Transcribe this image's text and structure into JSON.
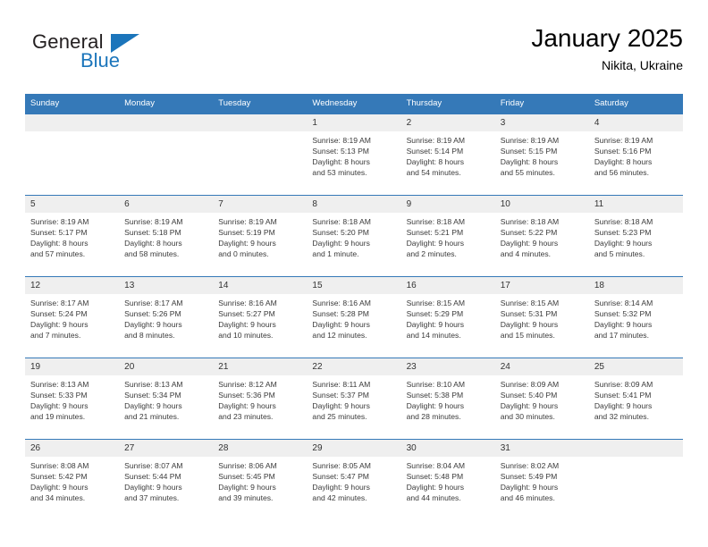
{
  "brand": {
    "name_top": "General",
    "name_bottom": "Blue",
    "triangle_color": "#1b75bb",
    "top_color": "#231f20",
    "bottom_color": "#1b75bb"
  },
  "header": {
    "title": "January 2025",
    "location": "Nikita, Ukraine"
  },
  "theme": {
    "header_bg": "#3579b8",
    "header_text": "#ffffff",
    "daynum_bg": "#efefef",
    "row_border": "#3579b8"
  },
  "weekdays": [
    "Sunday",
    "Monday",
    "Tuesday",
    "Wednesday",
    "Thursday",
    "Friday",
    "Saturday"
  ],
  "weeks": [
    [
      {
        "day": "",
        "details": ""
      },
      {
        "day": "",
        "details": ""
      },
      {
        "day": "",
        "details": ""
      },
      {
        "day": "1",
        "details": "Sunrise: 8:19 AM\nSunset: 5:13 PM\nDaylight: 8 hours\nand 53 minutes."
      },
      {
        "day": "2",
        "details": "Sunrise: 8:19 AM\nSunset: 5:14 PM\nDaylight: 8 hours\nand 54 minutes."
      },
      {
        "day": "3",
        "details": "Sunrise: 8:19 AM\nSunset: 5:15 PM\nDaylight: 8 hours\nand 55 minutes."
      },
      {
        "day": "4",
        "details": "Sunrise: 8:19 AM\nSunset: 5:16 PM\nDaylight: 8 hours\nand 56 minutes."
      }
    ],
    [
      {
        "day": "5",
        "details": "Sunrise: 8:19 AM\nSunset: 5:17 PM\nDaylight: 8 hours\nand 57 minutes."
      },
      {
        "day": "6",
        "details": "Sunrise: 8:19 AM\nSunset: 5:18 PM\nDaylight: 8 hours\nand 58 minutes."
      },
      {
        "day": "7",
        "details": "Sunrise: 8:19 AM\nSunset: 5:19 PM\nDaylight: 9 hours\nand 0 minutes."
      },
      {
        "day": "8",
        "details": "Sunrise: 8:18 AM\nSunset: 5:20 PM\nDaylight: 9 hours\nand 1 minute."
      },
      {
        "day": "9",
        "details": "Sunrise: 8:18 AM\nSunset: 5:21 PM\nDaylight: 9 hours\nand 2 minutes."
      },
      {
        "day": "10",
        "details": "Sunrise: 8:18 AM\nSunset: 5:22 PM\nDaylight: 9 hours\nand 4 minutes."
      },
      {
        "day": "11",
        "details": "Sunrise: 8:18 AM\nSunset: 5:23 PM\nDaylight: 9 hours\nand 5 minutes."
      }
    ],
    [
      {
        "day": "12",
        "details": "Sunrise: 8:17 AM\nSunset: 5:24 PM\nDaylight: 9 hours\nand 7 minutes."
      },
      {
        "day": "13",
        "details": "Sunrise: 8:17 AM\nSunset: 5:26 PM\nDaylight: 9 hours\nand 8 minutes."
      },
      {
        "day": "14",
        "details": "Sunrise: 8:16 AM\nSunset: 5:27 PM\nDaylight: 9 hours\nand 10 minutes."
      },
      {
        "day": "15",
        "details": "Sunrise: 8:16 AM\nSunset: 5:28 PM\nDaylight: 9 hours\nand 12 minutes."
      },
      {
        "day": "16",
        "details": "Sunrise: 8:15 AM\nSunset: 5:29 PM\nDaylight: 9 hours\nand 14 minutes."
      },
      {
        "day": "17",
        "details": "Sunrise: 8:15 AM\nSunset: 5:31 PM\nDaylight: 9 hours\nand 15 minutes."
      },
      {
        "day": "18",
        "details": "Sunrise: 8:14 AM\nSunset: 5:32 PM\nDaylight: 9 hours\nand 17 minutes."
      }
    ],
    [
      {
        "day": "19",
        "details": "Sunrise: 8:13 AM\nSunset: 5:33 PM\nDaylight: 9 hours\nand 19 minutes."
      },
      {
        "day": "20",
        "details": "Sunrise: 8:13 AM\nSunset: 5:34 PM\nDaylight: 9 hours\nand 21 minutes."
      },
      {
        "day": "21",
        "details": "Sunrise: 8:12 AM\nSunset: 5:36 PM\nDaylight: 9 hours\nand 23 minutes."
      },
      {
        "day": "22",
        "details": "Sunrise: 8:11 AM\nSunset: 5:37 PM\nDaylight: 9 hours\nand 25 minutes."
      },
      {
        "day": "23",
        "details": "Sunrise: 8:10 AM\nSunset: 5:38 PM\nDaylight: 9 hours\nand 28 minutes."
      },
      {
        "day": "24",
        "details": "Sunrise: 8:09 AM\nSunset: 5:40 PM\nDaylight: 9 hours\nand 30 minutes."
      },
      {
        "day": "25",
        "details": "Sunrise: 8:09 AM\nSunset: 5:41 PM\nDaylight: 9 hours\nand 32 minutes."
      }
    ],
    [
      {
        "day": "26",
        "details": "Sunrise: 8:08 AM\nSunset: 5:42 PM\nDaylight: 9 hours\nand 34 minutes."
      },
      {
        "day": "27",
        "details": "Sunrise: 8:07 AM\nSunset: 5:44 PM\nDaylight: 9 hours\nand 37 minutes."
      },
      {
        "day": "28",
        "details": "Sunrise: 8:06 AM\nSunset: 5:45 PM\nDaylight: 9 hours\nand 39 minutes."
      },
      {
        "day": "29",
        "details": "Sunrise: 8:05 AM\nSunset: 5:47 PM\nDaylight: 9 hours\nand 42 minutes."
      },
      {
        "day": "30",
        "details": "Sunrise: 8:04 AM\nSunset: 5:48 PM\nDaylight: 9 hours\nand 44 minutes."
      },
      {
        "day": "31",
        "details": "Sunrise: 8:02 AM\nSunset: 5:49 PM\nDaylight: 9 hours\nand 46 minutes."
      },
      {
        "day": "",
        "details": ""
      }
    ]
  ]
}
